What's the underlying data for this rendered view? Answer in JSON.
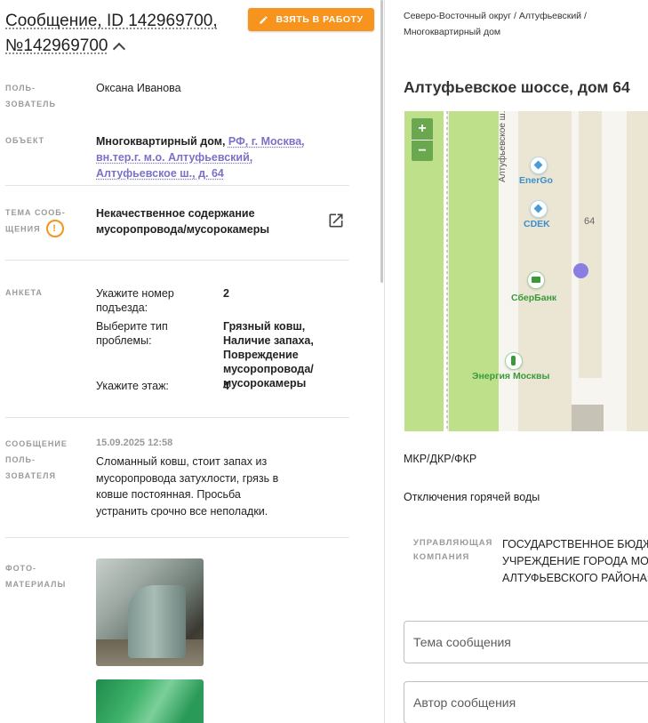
{
  "header": {
    "title_line1": "Сообщение, ID 142969700,",
    "title_line2": "№142969700",
    "take_button": "ВЗЯТЬ В РАБОТУ"
  },
  "user": {
    "label": "ПОЛЬ-ЗОВАТЕЛЬ",
    "value": "Оксана Иванова"
  },
  "object": {
    "label": "ОБЪЕКТ",
    "type": "Многоквартирный дом,",
    "address_link": "РФ, г. Москва, вн.тер.г. м.о. Алтуфьевский, Алтуфьевское ш., д. 64"
  },
  "topic": {
    "label": "ТЕМА СООБ-ЩЕНИЯ",
    "value": "Некачественное содержание мусоропровода/мусорокамеры"
  },
  "survey": {
    "label": "АНКЕТА",
    "items": [
      {
        "question": "Укажите номер подъезда:",
        "answer": "2"
      },
      {
        "question": "Выберите тип проблемы:",
        "answer": "Грязный ковш, Наличие запаха, Повреждение мусоропровода/ мусорокамеры"
      },
      {
        "question": "Укажите этаж:",
        "answer": "4"
      }
    ]
  },
  "message": {
    "label": "СООБЩЕНИЕ ПОЛЬ-ЗОВАТЕЛЯ",
    "date": "15.09.2025 12:58",
    "text": "Сломанный ковш, стоит запах из мусоропровода затухлости, грязь в ковше постоянная. Просьба устранить срочно все неполадки."
  },
  "photos": {
    "label": "ФОТО-МАТЕРИАЛЫ"
  },
  "right": {
    "breadcrumb": "Северо-Восточный округ / Алтуфьевский / Многоквартирный дом",
    "address": "Алтуфьевское шоссе, дом 64",
    "mkr": "МКР/ДКР/ФКР",
    "hot_water": "Отключения горячей воды",
    "uk_label": "УПРАВЛЯЮЩАЯ КОМПАНИЯ",
    "uk_line1": "ГОСУДАРСТВЕННОЕ БЮДЖЕ",
    "uk_line2": "УЧРЕЖДЕНИЕ ГОРОДА МОС",
    "uk_line3": "АЛТУФЬЕВСКОГО РАЙОНА»",
    "topic_placeholder": "Тема сообщения",
    "author_placeholder": "Автор сообщения"
  },
  "map": {
    "zoom_in": "+",
    "zoom_out": "−",
    "street": "Алтуфьевское ш.",
    "house": "64",
    "pois": [
      "EnerGo",
      "CDEK",
      "СберБанк",
      "Энергия Москвы"
    ],
    "colors": {
      "park": "#bfe08a",
      "road": "#f5f3ec",
      "poi_blue": "#4a9bd6",
      "poi_green": "#3a9a3a",
      "marker": "#8a7ee3"
    }
  },
  "colors": {
    "accent": "#f7941d",
    "link": "#7b72c6"
  }
}
